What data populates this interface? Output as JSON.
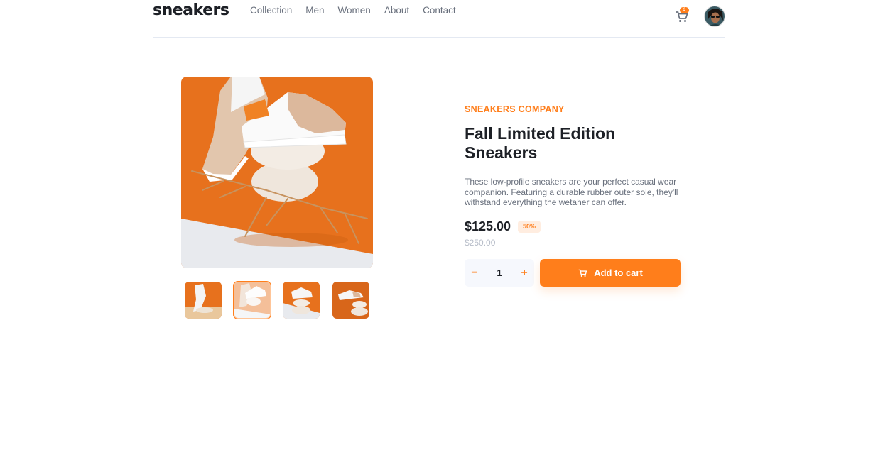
{
  "header": {
    "logo": "sneakers",
    "nav": [
      "Collection",
      "Men",
      "Women",
      "About",
      "Contact"
    ],
    "cart_count": "3",
    "cart_icon": "cart-icon",
    "avatar_icon": "avatar"
  },
  "product": {
    "company": "SNEAKERS COMPANY",
    "title": "Fall Limited Edition Sneakers",
    "description": "These low-profile sneakers are your perfect casual wear companion. Featuring a durable rubber outer sole, they'll withstand everything the wetaher can offer.",
    "price": "$125.00",
    "discount": "50%",
    "old_price": "$250.00",
    "quantity": "1",
    "minus_label": "−",
    "plus_label": "+",
    "add_to_cart": "Add to cart"
  },
  "gallery": {
    "selected_thumbnail": 2,
    "thumbnail_count": 4
  },
  "colors": {
    "accent": "#ff7e1b",
    "text_dark": "#1d2026",
    "text_muted": "#69707d",
    "badge_bg": "#ffede0"
  }
}
